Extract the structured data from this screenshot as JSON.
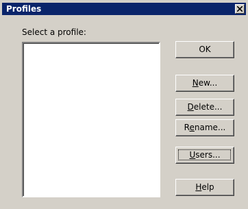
{
  "window": {
    "title": "Profiles"
  },
  "icons": {
    "close": "close-icon"
  },
  "label": "Select a profile:",
  "buttons": {
    "ok": {
      "label": "OK"
    },
    "new": {
      "mnemonic": "N",
      "rest": "ew..."
    },
    "delete": {
      "mnemonic": "D",
      "rest": "elete..."
    },
    "rename": {
      "prefix": "R",
      "mnemonic": "e",
      "rest": "name..."
    },
    "users": {
      "mnemonic": "U",
      "rest": "sers..."
    },
    "help": {
      "mnemonic": "H",
      "rest": "elp"
    }
  },
  "colors": {
    "titlebar": "#0a246a",
    "face": "#d4d0c8"
  }
}
